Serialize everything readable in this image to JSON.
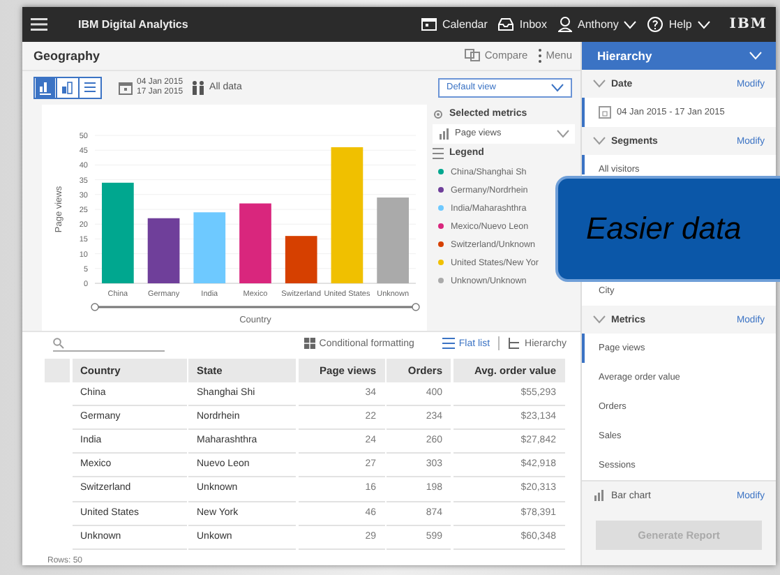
{
  "app": {
    "title": "IBM Digital Analytics",
    "logo": "IBM"
  },
  "top_nav": [
    {
      "label": "Calendar",
      "kind": "calendar",
      "dropdown": false
    },
    {
      "label": "Inbox",
      "kind": "inbox",
      "dropdown": false
    },
    {
      "label": "Anthony",
      "kind": "user",
      "dropdown": true
    },
    {
      "label": "Help",
      "kind": "help",
      "dropdown": true
    }
  ],
  "report": {
    "title": "Geography",
    "actions": [
      {
        "label": "Compare",
        "kind": "compare"
      },
      {
        "label": "Menu",
        "kind": "menu"
      }
    ],
    "view_modes": [
      {
        "kind": "bar",
        "selected": true
      },
      {
        "kind": "column",
        "selected": false
      },
      {
        "kind": "list",
        "selected": false
      }
    ],
    "date_range": {
      "start": "04 Jan 2015",
      "end": "17 Jan 2015"
    },
    "segment": "All data",
    "view_select": {
      "value": "Default view"
    },
    "chart_data": {
      "type": "bar",
      "xlabel": "Country",
      "ylabel": "Page views",
      "categories": [
        "China",
        "Germany",
        "India",
        "Mexico",
        "Switzerland",
        "United States",
        "Unknown"
      ],
      "values": [
        34,
        22,
        24,
        27,
        16,
        46,
        29
      ],
      "ylim": [
        0,
        50
      ],
      "grid": true,
      "yticks": [
        0,
        5,
        10,
        15,
        20,
        25,
        30,
        35,
        40,
        45,
        50
      ]
    },
    "selected_metrics": {
      "title": "Selected metrics",
      "metric": "Page views"
    },
    "legend": {
      "title": "Legend",
      "items": [
        {
          "label": "China/Shanghai Sh",
          "color": "#00a78f"
        },
        {
          "label": "Germany/Nordrhein",
          "color": "#6f3f9a"
        },
        {
          "label": "India/Maharashthra",
          "color": "#6ec9ff"
        },
        {
          "label": "Mexico/Nuevo Leon",
          "color": "#d9267d"
        },
        {
          "label": "Switzerland/Unknown",
          "color": "#d64000"
        },
        {
          "label": "United States/New Yor",
          "color": "#f0c000"
        },
        {
          "label": "Unknown/Unknown",
          "color": "#aaaaaa"
        }
      ]
    },
    "table_tools": {
      "conditional_formatting": "Conditional formatting",
      "layouts": [
        {
          "label": "Flat list",
          "kind": "flat",
          "selected": true
        },
        {
          "label": "Hierarchy",
          "kind": "tree",
          "selected": false
        }
      ]
    },
    "table": {
      "columns": [
        "Country",
        "State",
        "Page views",
        "Orders",
        "Avg. order value"
      ],
      "rows": [
        [
          "China",
          "Shanghai Shi",
          "34",
          "400",
          "$55,293"
        ],
        [
          "Germany",
          "Nordrhein",
          "22",
          "234",
          "$23,134"
        ],
        [
          "India",
          "Maharashthra",
          "24",
          "260",
          "$27,842"
        ],
        [
          "Mexico",
          "Nuevo Leon",
          "27",
          "303",
          "$42,918"
        ],
        [
          "Switzerland",
          "Unknown",
          "16",
          "198",
          "$20,313"
        ],
        [
          "United States",
          "New York",
          "46",
          "874",
          "$78,391"
        ],
        [
          "Unknown",
          "Unkown",
          "29",
          "599",
          "$60,348"
        ]
      ]
    },
    "row_count": "Rows: 50"
  },
  "hierarchy": {
    "title": "Hierarchy",
    "sections": [
      {
        "title": "Date",
        "action": "Modify",
        "items": [
          {
            "label": "04 Jan 2015 - 17 Jan 2015",
            "kind": "date",
            "selected": true
          }
        ]
      },
      {
        "title": "Segments",
        "action": "Modify",
        "items": [
          {
            "label": "All visitors",
            "kind": "text",
            "selected": true
          },
          {
            "label": "City",
            "kind": "text",
            "selected": false
          }
        ]
      },
      {
        "title": "Metrics",
        "action": "Modify",
        "items": [
          {
            "label": "Page views",
            "kind": "text",
            "selected": true
          },
          {
            "label": "Average order value",
            "kind": "text",
            "selected": false
          },
          {
            "label": "Orders",
            "kind": "text",
            "selected": false
          },
          {
            "label": "Sales",
            "kind": "text",
            "selected": false
          },
          {
            "label": "Sessions",
            "kind": "text",
            "selected": false
          }
        ]
      }
    ],
    "chart_type": {
      "label": "Bar chart",
      "action": "Modify"
    },
    "generate": {
      "label": "Generate Report",
      "disabled": true
    }
  },
  "callout": {
    "text": "Easier data"
  }
}
